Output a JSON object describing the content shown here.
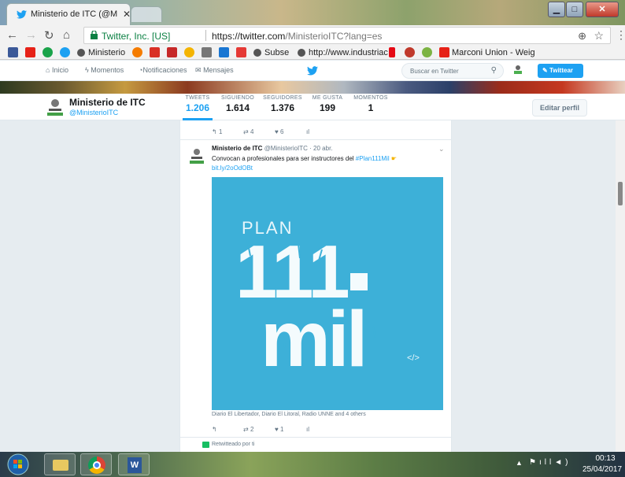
{
  "browser": {
    "tab_title": "Ministerio de ITC (@Mini",
    "cert_label": "Twitter, Inc. [US]",
    "url_host": "https://twitter.com",
    "url_path": "/MinisterioITC?lang=es"
  },
  "bookmarks": [
    {
      "label": "Ministerio"
    },
    {
      "label": "Subse"
    },
    {
      "label": "http://www.industriac"
    },
    {
      "label": "Marconi Union - Weig"
    }
  ],
  "twitter_nav": {
    "home": "Inicio",
    "moments": "Momentos",
    "notifications": "Notificaciones",
    "messages": "Mensajes",
    "search_placeholder": "Buscar en Twitter",
    "tweet_button": "Twittear"
  },
  "profile": {
    "name": "Ministerio de ITC",
    "handle": "@MinisterioITC",
    "stats": [
      {
        "label": "TWEETS",
        "value": "1.206"
      },
      {
        "label": "SIGUIENDO",
        "value": "1.614"
      },
      {
        "label": "SEGUIDORES",
        "value": "1.376"
      },
      {
        "label": "ME GUSTA",
        "value": "199"
      },
      {
        "label": "MOMENTOS",
        "value": "1"
      }
    ],
    "edit_button": "Editar perfil"
  },
  "prev_tweet": {
    "retweets": "4",
    "likes": "6",
    "replies": "1"
  },
  "tweet": {
    "author": "Ministerio de ITC",
    "handle": "@MinisterioITC",
    "time": "· 20 abr.",
    "text_prefix": "Convocan a profesionales para ser instructores del ",
    "hashtag": "#Plan111Mil",
    "link": "bit.ly/2oOdOBt",
    "image_title": "PLAN",
    "image_number": "111",
    "image_word": "mil",
    "image_code": "</>",
    "media_credit": "Diario El Libertador, Diario El Litoral, Radio UNNE and 4 others",
    "retweets": "2",
    "likes": "1",
    "retweeted_label": "Retwitteado por ti"
  },
  "taskbar": {
    "time": "00:13",
    "date": "25/04/2017"
  },
  "colors": {
    "twitter_blue": "#1da1f2",
    "plan_bg": "#3db0d8"
  }
}
